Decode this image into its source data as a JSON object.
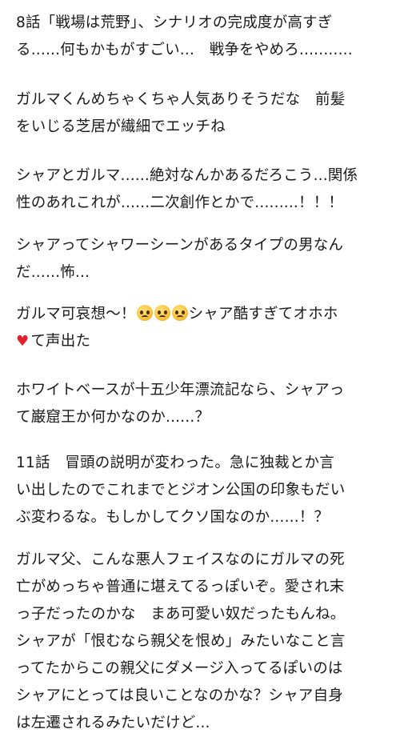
{
  "paragraphs": [
    {
      "lines": [
        "8話「戦場は荒野」、シナリオの完成度が高すぎ",
        "る......何もかもがすごい...　戦争をやめろ..........."
      ]
    },
    {
      "lines": [
        "ガルマくんめちゃくちゃ人気ありそうだな　前髪",
        "をいじる芝居が繊細でエッチね"
      ]
    },
    {
      "lines": [
        "シャアとガルマ......絶対なんかあるだろこう...関係",
        "性のあれこれが......二次創作とかで.........！！！"
      ]
    },
    {
      "lines": [
        "シャアってシャワーシーンがあるタイプの男なん",
        "だ......怖..."
      ]
    },
    {
      "line1_pre": "ガルマ可哀想〜！",
      "emoji_name": "pleading-face-icon",
      "line1_post": "シャア酷すぎてオホホ",
      "heart_glyph": "♥",
      "line2_post": "て声出た"
    },
    {
      "lines": [
        "ホワイトベースが十五少年漂流記なら、シャアっ",
        "て巌窟王か何かなのか......？"
      ]
    },
    {
      "lines": [
        "11話　冒頭の説明が変わった。急に独裁とか言",
        "い出したのでこれまでとジオン公国の印象もだい",
        "ぶ変わるな。もしかしてクソ国なのか......！？"
      ]
    },
    {
      "lines": [
        "ガルマ父、こんな悪人フェイスなのにガルマの死",
        "亡がめっちゃ普通に堪えてるっぽいぞ。愛され末",
        "っ子だったのかな　まあ可愛い奴だったもんね。",
        "シャアが「恨むなら親父を恨め」みたいなこと言",
        "ってたからこの親父にダメージ入ってるぽいのは",
        "シャアにとっては良いことなのかな？シャア自身",
        "は左遷されるみたいだけど..."
      ]
    }
  ]
}
